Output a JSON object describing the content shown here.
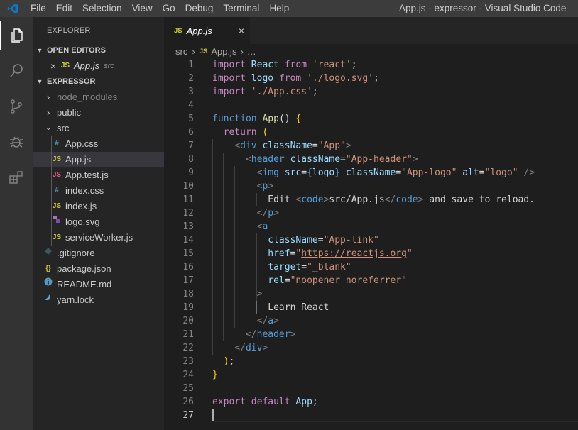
{
  "titlebar": {
    "menu": [
      "File",
      "Edit",
      "Selection",
      "View",
      "Go",
      "Debug",
      "Terminal",
      "Help"
    ],
    "window_title": "App.js - expressor - Visual Studio Code"
  },
  "activity_bar": {
    "items": [
      "explorer-icon",
      "search-icon",
      "source-control-icon",
      "debug-icon",
      "extensions-icon"
    ],
    "accent": "#ffffff"
  },
  "sidebar": {
    "title": "EXPLORER",
    "open_editors": {
      "header": "OPEN EDITORS",
      "items": [
        {
          "icon_text": "JS",
          "name": "App.js",
          "folder": "src"
        }
      ]
    },
    "project": {
      "header": "EXPRESSOR",
      "tree": [
        {
          "name": "node_modules",
          "kind": "folder",
          "open": false
        },
        {
          "name": "public",
          "kind": "folder",
          "open": false
        },
        {
          "name": "src",
          "kind": "folder",
          "open": true
        },
        {
          "name": "App.css",
          "kind": "css"
        },
        {
          "name": "App.js",
          "kind": "js",
          "selected": true
        },
        {
          "name": "App.test.js",
          "kind": "js"
        },
        {
          "name": "index.css",
          "kind": "css"
        },
        {
          "name": "index.js",
          "kind": "js"
        },
        {
          "name": "logo.svg",
          "kind": "svg"
        },
        {
          "name": "serviceWorker.js",
          "kind": "js"
        },
        {
          "name": ".gitignore",
          "kind": "diamond"
        },
        {
          "name": "package.json",
          "kind": "json"
        },
        {
          "name": "README.md",
          "kind": "info"
        },
        {
          "name": "yarn.lock",
          "kind": "yarn"
        }
      ],
      "icon_texts": {
        "js": "JS",
        "css": "#",
        "json": "{}",
        "info": "i"
      }
    }
  },
  "tabs": [
    {
      "icon_text": "JS",
      "label": "App.js",
      "close_glyph": "×"
    }
  ],
  "breadcrumb": {
    "folder": "src",
    "sep": "›",
    "file_icon": "JS",
    "file": "App.js",
    "more": "…"
  },
  "editor": {
    "active_line": 27,
    "line_numbers": [
      "1",
      "2",
      "3",
      "4",
      "5",
      "6",
      "7",
      "8",
      "9",
      "10",
      "11",
      "12",
      "13",
      "14",
      "15",
      "16",
      "17",
      "18",
      "19",
      "20",
      "21",
      "22",
      "23",
      "24",
      "25",
      "26",
      "27"
    ],
    "lines": [
      "import React from 'react';",
      "import logo from './logo.svg';",
      "import './App.css';",
      "",
      "function App() {",
      "  return (",
      "    <div className=\"App\">",
      "      <header className=\"App-header\">",
      "        <img src={logo} className=\"App-logo\" alt=\"logo\" />",
      "        <p>",
      "          Edit <code>src/App.js</code> and save to reload.",
      "        </p>",
      "        <a",
      "          className=\"App-link\"",
      "          href=\"https://reactjs.org\"",
      "          target=\"_blank\"",
      "          rel=\"noopener noreferrer\"",
      "        >",
      "          Learn React",
      "        </a>",
      "      </header>",
      "    </div>",
      "  );",
      "}",
      "",
      "export default App;",
      ""
    ],
    "tokens": {
      "import": "import",
      "from": "from",
      "function": "function",
      "return": "return",
      "export": "export",
      "default": "default",
      "react_id": "React",
      "logo_id": "logo",
      "app_id": "App",
      "s_react": "'react'",
      "s_logo": "'./logo.svg'",
      "s_css": "'./App.css'",
      "lt": "<",
      "gt": ">",
      "lts": "</",
      "sgt": " />",
      "div": "div",
      "header": "header",
      "img": "img",
      "p": "p",
      "code": "code",
      "a": "a",
      "className": "className",
      "src": "src",
      "alt": "alt",
      "href": "href",
      "target": "target",
      "rel": "rel",
      "eq": "=",
      "v_App": "\"App\"",
      "v_header": "\"App-header\"",
      "v_logo": "\"App-logo\"",
      "v_alt": "\"logo\"",
      "v_link": "\"App-link\"",
      "v_href_q": "\"",
      "v_href_url": "https://reactjs.org",
      "v_blank": "\"_blank\"",
      "v_rel": "\"noopener noreferrer\"",
      "edit": "Edit ",
      "srcpath": "src/App.js",
      "save": " and save to reload.",
      "learn": "Learn React",
      "open_brace_expr": "{",
      "close_brace_expr": "}",
      "paren_open": "(",
      "paren_close": ")",
      "parens": "()",
      "semicolon": ";",
      "close_paren_semi": ");",
      "fn_brace_open": "{",
      "fn_brace_close": "}"
    }
  }
}
